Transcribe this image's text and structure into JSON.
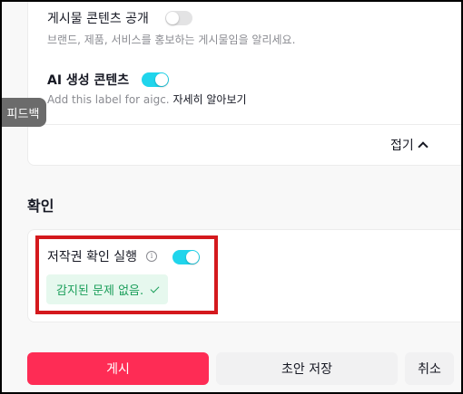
{
  "settings": {
    "public_content_title": "게시물 콘텐츠 공개",
    "public_content_desc": "브랜드, 제품, 서비스를 홍보하는 게시물임을 알리세요.",
    "ai_content_title": "AI 생성 콘텐츠",
    "ai_content_desc": "Add this label for aigc.",
    "ai_learn_more": "자세히 알아보기",
    "collapse_label": "접기"
  },
  "feedback_label": "피드백",
  "check_section": {
    "title": "확인",
    "copyright_check_label": "저작권 확인 실행",
    "status_text": "감지된 문제 없음."
  },
  "actions": {
    "post_label": "게시",
    "draft_label": "초안 저장",
    "cancel_label": "취소"
  },
  "colors": {
    "accent": "#fe2c55",
    "toggle_on": "#20d5ec",
    "success": "#1a9e5a",
    "highlight": "#d4191d"
  }
}
